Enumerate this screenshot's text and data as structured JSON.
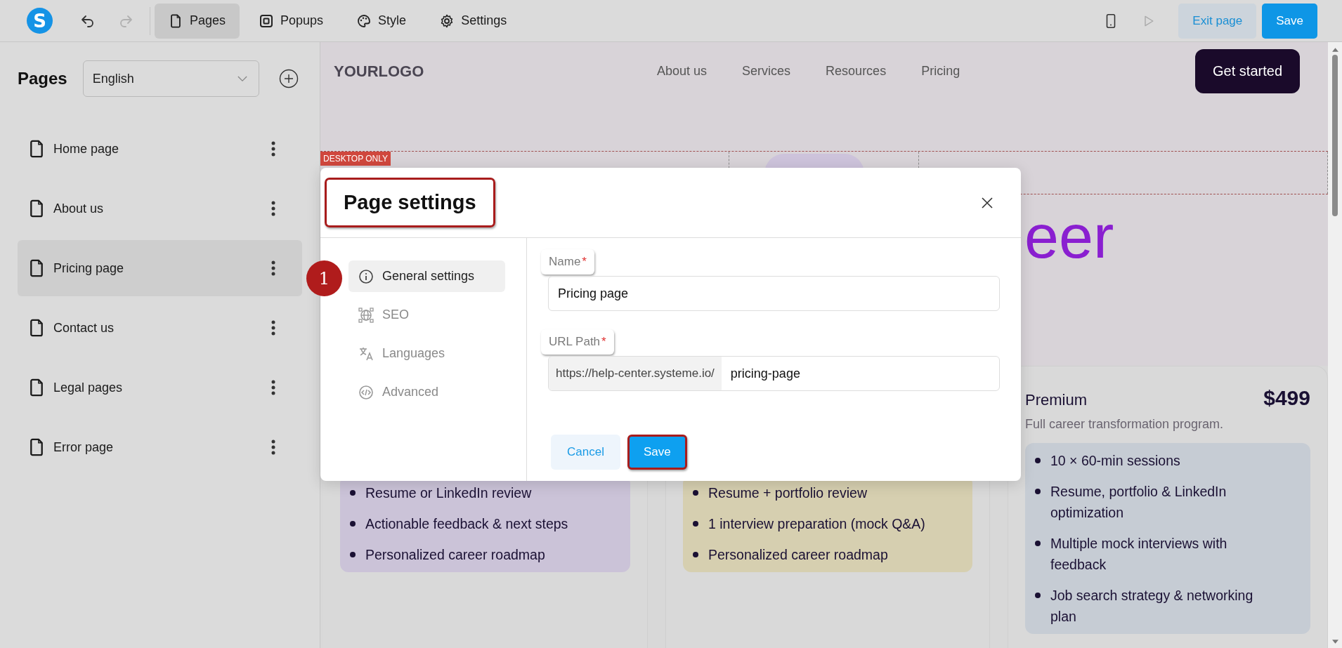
{
  "toolbar": {
    "logo": "S",
    "undo_disabled": false,
    "redo_disabled": true,
    "tabs": [
      {
        "label": "Pages",
        "kind": "page",
        "selected": true
      },
      {
        "label": "Popups",
        "kind": "popup",
        "selected": false
      },
      {
        "label": "Style",
        "kind": "palette",
        "selected": false
      },
      {
        "label": "Settings",
        "kind": "gear",
        "selected": false
      }
    ],
    "exit_button": "Exit page",
    "save_button": "Save"
  },
  "sidebar": {
    "title": "Pages",
    "language": "English",
    "items": [
      {
        "label": "Home page",
        "selected": false
      },
      {
        "label": "About us",
        "selected": false
      },
      {
        "label": "Pricing page",
        "selected": true
      },
      {
        "label": "Contact us",
        "selected": false
      },
      {
        "label": "Legal pages",
        "selected": false
      },
      {
        "label": "Error page",
        "selected": false
      }
    ]
  },
  "canvas": {
    "logo": "YOURLOGO",
    "nav": [
      "About us",
      "Services",
      "Resources",
      "Pricing"
    ],
    "cta": "Get started",
    "section_tag": "DESKTOP ONLY",
    "hero_fragment": "eer",
    "cards": [
      {
        "color": "#cbc3d8",
        "features": [
          "Resume or LinkedIn review",
          "Actionable feedback & next steps",
          "Personalized career roadmap"
        ]
      },
      {
        "color": "#d6cfb0",
        "features": [
          "Resume + portfolio review",
          "1 interview preparation (mock Q&A)",
          "Personalized career roadmap"
        ]
      },
      {
        "color": "#c6ccd4",
        "title": "Premium",
        "price": "$499",
        "description": "Full career transformation program.",
        "features": [
          "10 × 60-min sessions",
          "Resume, portfolio & LinkedIn optimization",
          "Multiple mock interviews with feedback",
          "Job search strategy & networking plan"
        ]
      }
    ]
  },
  "modal": {
    "title": "Page settings",
    "title_highlighted": true,
    "step_badge": "1",
    "nav": [
      {
        "label": "General settings",
        "kind": "info",
        "selected": true
      },
      {
        "label": "SEO",
        "kind": "globe",
        "selected": false
      },
      {
        "label": "Languages",
        "kind": "translate",
        "selected": false
      },
      {
        "label": "Advanced",
        "kind": "code",
        "selected": false
      }
    ],
    "fields": [
      {
        "label": "Name",
        "required_mark": "*",
        "highlighted": true,
        "value": "Pricing page"
      },
      {
        "label": "URL Path",
        "required_mark": "*",
        "highlighted": true,
        "prefix": "https://help-center.systeme.io/",
        "value": "pricing-page"
      }
    ],
    "cancel_button": "Cancel",
    "save_button": {
      "label": "Save",
      "highlighted": true
    }
  }
}
